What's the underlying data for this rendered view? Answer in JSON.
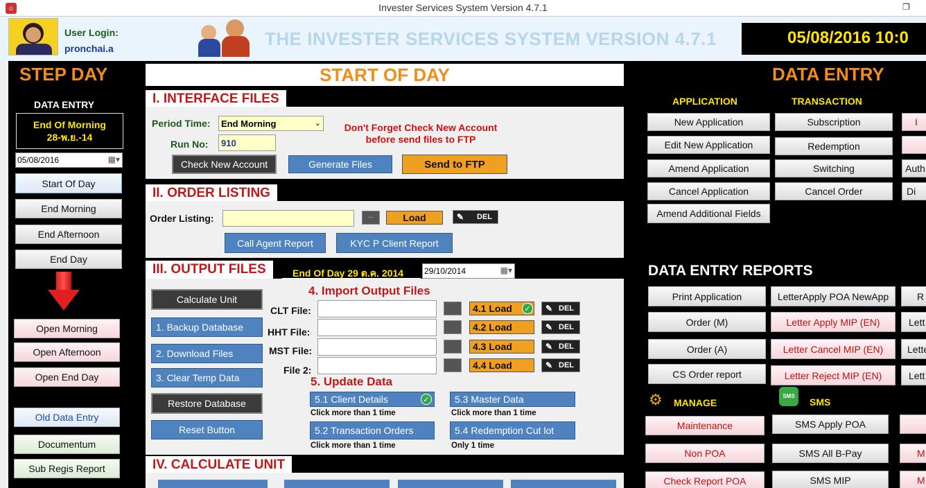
{
  "window": {
    "title": "Invester Services System Version 4.7.1"
  },
  "header": {
    "user_login_label": "User Login:",
    "username": "pronchai.a",
    "app_title": "THE INVESTER SERVICES SYSTEM VERSION 4.7.1",
    "datetime": "05/08/2016 10:0"
  },
  "left": {
    "title": "STEP DAY",
    "data_entry_label": "DATA ENTRY",
    "status_line1": "End Of Morning",
    "status_line2": "28-พ.ย.-14",
    "date_value": "05/08/2016",
    "buttons": [
      "Start Of Day",
      "End Morning",
      "End Afternoon",
      "End Day",
      "Open Morning",
      "Open Afternoon",
      "Open End Day",
      "Old Data Entry",
      "Documentum",
      "Sub Regis Report"
    ]
  },
  "center": {
    "title": "START OF DAY",
    "sec1": {
      "title": "I. INTERFACE FILES",
      "period_label": "Period Time:",
      "period_value": "End Morning",
      "runno_label": "Run No:",
      "runno_value": "910",
      "warning_line1": "Don't Forget Check New Account",
      "warning_line2": "before send files to FTP",
      "btn_check": "Check New Account",
      "btn_generate": "Generate Files",
      "btn_ftp": "Send to FTP"
    },
    "sec2": {
      "title": "II. ORDER LISTING",
      "label": "Order Listing:",
      "dots": "...",
      "load": "Load",
      "del": "DEL",
      "btn_agent": "Call Agent Report",
      "btn_kyc": "KYC P Client Report"
    },
    "sec3": {
      "title": "III. OUTPUT FILES",
      "eod_label": "End Of Day 29 ต.ค. 2014",
      "eod_date": "29/10/2014",
      "btn_calc": "Calculate Unit",
      "btn_backup": "1. Backup Database",
      "btn_download": "2. Download Files",
      "btn_clear": "3. Clear Temp Data",
      "btn_restore": "Restore Database",
      "btn_reset": "Reset Button",
      "import_title": "4. Import Output Files",
      "files": [
        {
          "label": "CLT File:",
          "load": "4.1 Load"
        },
        {
          "label": "HHT File:",
          "load": "4.2 Load"
        },
        {
          "label": "MST File:",
          "load": "4.3 Load"
        },
        {
          "label": "File 2:",
          "load": "4.4 Load"
        }
      ],
      "update_title": "5. Update Data",
      "upd1": "5.1 Client Details",
      "upd1_note": "Click more than 1 time",
      "upd3": "5.3 Master Data",
      "upd3_note": "Click more than 1 time",
      "upd2": "5.2 Transaction Orders",
      "upd2_note": "Click more than 1 time",
      "upd4": "5.4 Redemption Cut lot",
      "upd4_note": "Only 1 time"
    },
    "sec4": {
      "title": "IV. CALCULATE UNIT"
    }
  },
  "right": {
    "title": "DATA ENTRY",
    "col_app": "APPLICATION",
    "col_trans": "TRANSACTION",
    "app_buttons": [
      "New Application",
      "Edit New Application",
      "Amend Application",
      "Cancel Application",
      "Amend Additional Fields"
    ],
    "trans_buttons": [
      "Subscription",
      "Redemption",
      "Switching",
      "Cancel Order"
    ],
    "col3_partial": [
      "I",
      "",
      "Auth",
      "Di"
    ],
    "reports_title": "DATA ENTRY REPORTS",
    "report_col1": [
      "Print Application",
      "Order (M)",
      "Order (A)",
      "CS Order report"
    ],
    "report_col2": [
      "LetterApply POA NewApp",
      "Letter Apply MIP (EN)",
      "Letter Cancel MIP (EN)",
      "Letter Reject MIP (EN)"
    ],
    "report_col3": [
      "R",
      "Lett",
      "Lette",
      "Lett"
    ],
    "manage_label": "MANAGE",
    "sms_label": "SMS",
    "sms_icon_text": "SMS",
    "manage_buttons": [
      "Maintenance",
      "Non POA",
      "Check Report POA"
    ],
    "sms_buttons": [
      "SMS Apply POA",
      "SMS All B-Pay",
      "SMS MIP"
    ],
    "col3_bottom": [
      "",
      "M",
      "M"
    ]
  }
}
